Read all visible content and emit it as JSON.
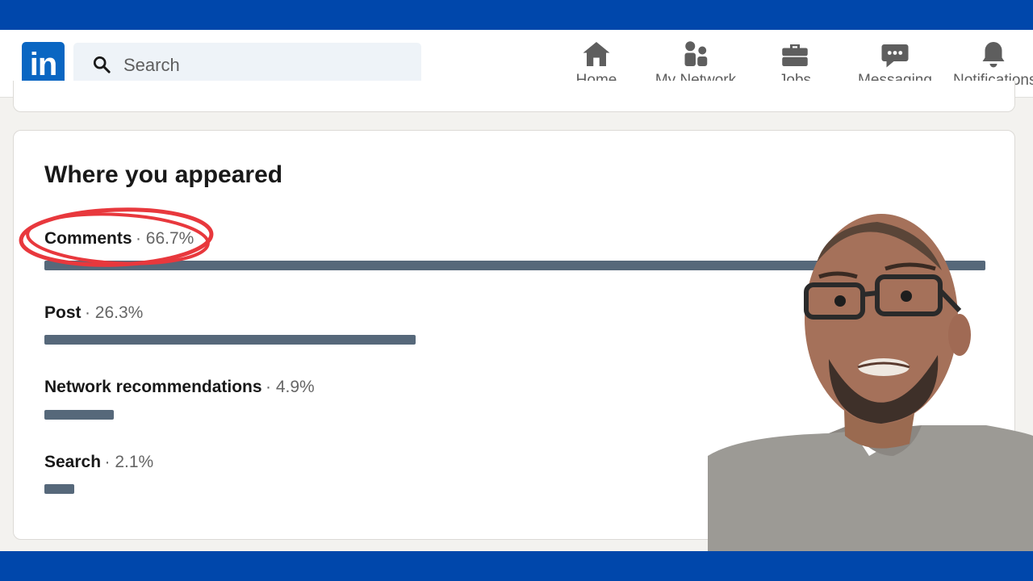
{
  "nav": {
    "logo_text": "in",
    "search_placeholder": "Search",
    "items": [
      {
        "label": "Home",
        "icon": "home-icon"
      },
      {
        "label": "My Network",
        "icon": "my-network-icon"
      },
      {
        "label": "Jobs",
        "icon": "briefcase-icon"
      },
      {
        "label": "Messaging",
        "icon": "messaging-icon"
      },
      {
        "label": "Notifications",
        "icon": "bell-icon"
      }
    ]
  },
  "card": {
    "title": "Where you appeared",
    "rows": [
      {
        "label": "Comments",
        "pct": "· 66.7%",
        "value": 66.7
      },
      {
        "label": "Post",
        "pct": "· 26.3%",
        "value": 26.3
      },
      {
        "label": "Network recommendations",
        "pct": "· 4.9%",
        "value": 4.9
      },
      {
        "label": "Search",
        "pct": "· 2.1%",
        "value": 2.1
      }
    ]
  },
  "colors": {
    "frame": "#0047ab",
    "bar": "#56687a",
    "annotation": "#e8383d",
    "linkedin_blue": "#0a66c2"
  }
}
